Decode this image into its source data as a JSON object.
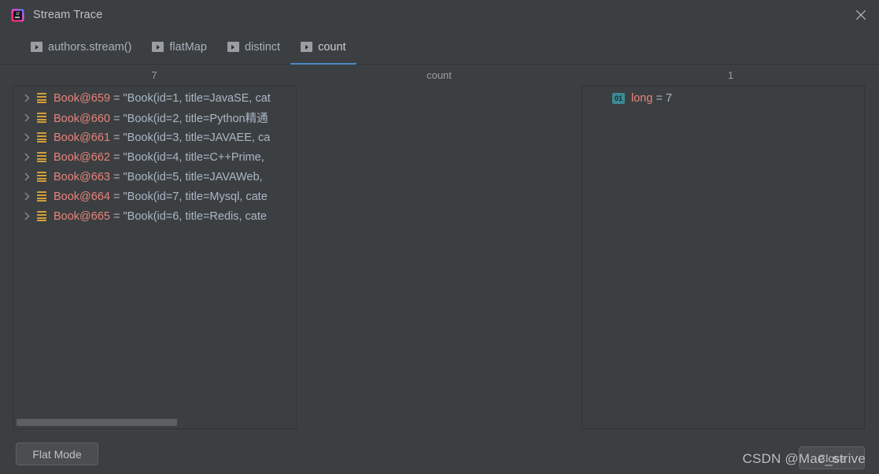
{
  "window": {
    "title": "Stream Trace",
    "app_icon": "intellij-idea-icon",
    "close_icon": "close-icon"
  },
  "tabs": [
    {
      "label": "authors.stream()",
      "icon": "run-arrow-icon",
      "active": false
    },
    {
      "label": "flatMap",
      "icon": "run-arrow-icon",
      "active": false
    },
    {
      "label": "distinct",
      "icon": "run-arrow-icon",
      "active": false
    },
    {
      "label": "count",
      "icon": "run-arrow-icon",
      "active": true
    }
  ],
  "columns": {
    "left_count": "7",
    "operation": "count",
    "right_count": "1"
  },
  "left_pane": {
    "rows": [
      {
        "name": "Book@659",
        "eq": "=",
        "value": "\"Book(id=1, title=JavaSE, cat",
        "icon": "array-list-icon",
        "expander": "chevron-right-icon"
      },
      {
        "name": "Book@660",
        "eq": "=",
        "value": "\"Book(id=2, title=Python精通",
        "icon": "array-list-icon",
        "expander": "chevron-right-icon"
      },
      {
        "name": "Book@661",
        "eq": "=",
        "value": "\"Book(id=3, title=JAVAEE, ca",
        "icon": "array-list-icon",
        "expander": "chevron-right-icon"
      },
      {
        "name": "Book@662",
        "eq": "=",
        "value": "\"Book(id=4, title=C++Prime,",
        "icon": "array-list-icon",
        "expander": "chevron-right-icon"
      },
      {
        "name": "Book@663",
        "eq": "=",
        "value": "\"Book(id=5, title=JAVAWeb,",
        "icon": "array-list-icon",
        "expander": "chevron-right-icon"
      },
      {
        "name": "Book@664",
        "eq": "=",
        "value": "\"Book(id=7, title=Mysql, cate",
        "icon": "array-list-icon",
        "expander": "chevron-right-icon"
      },
      {
        "name": "Book@665",
        "eq": "=",
        "value": "\"Book(id=6, title=Redis, cate",
        "icon": "array-list-icon",
        "expander": "chevron-right-icon"
      }
    ],
    "hscrollbar": "horizontal-scrollbar"
  },
  "right_pane": {
    "rows": [
      {
        "badge": "01",
        "name": "long",
        "eq": "=",
        "value": "7",
        "icon": "primitive-long-icon"
      }
    ]
  },
  "footer": {
    "flat_mode_label": "Flat Mode",
    "close_label": "Close"
  },
  "watermark": "CSDN @Mae_strive",
  "colors": {
    "window_bg": "#3c3f41",
    "pane_border": "#323437",
    "tab_active_underline": "#4a88c7",
    "variable_name": "#e8837c",
    "variable_value": "#a9b7c6",
    "list_icon": "#d3a03a",
    "badge_bg": "#3d8a94",
    "scrollbar_thumb": "#5c5f61"
  }
}
